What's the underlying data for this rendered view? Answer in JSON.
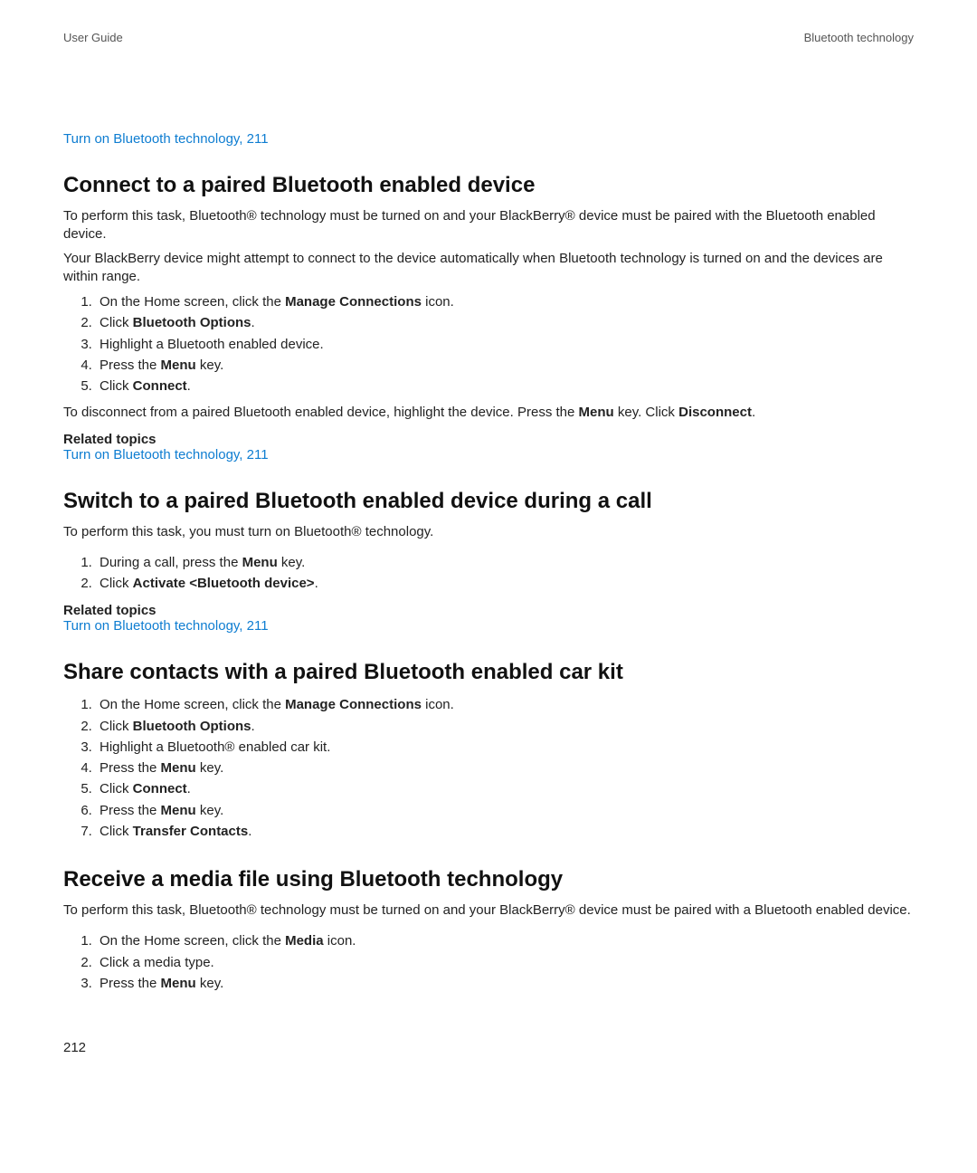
{
  "header": {
    "left": "User Guide",
    "right": "Bluetooth technology"
  },
  "introLink": "Turn on Bluetooth technology, 211",
  "s1": {
    "title": "Connect to a paired Bluetooth enabled device",
    "p1": "To perform this task, Bluetooth® technology must be turned on and your BlackBerry® device must be paired with the Bluetooth enabled device.",
    "p2": "Your BlackBerry device might attempt to connect to the device automatically when Bluetooth technology is turned on and the devices are within range.",
    "steps": {
      "s1a": "On the Home screen, click the ",
      "s1b": "Manage Connections",
      "s1c": " icon.",
      "s2a": "Click ",
      "s2b": "Bluetooth Options",
      "s2c": ".",
      "s3": "Highlight a Bluetooth enabled device.",
      "s4a": "Press the ",
      "s4b": "Menu",
      "s4c": " key.",
      "s5a": "Click ",
      "s5b": "Connect",
      "s5c": "."
    },
    "p3a": "To disconnect from a paired Bluetooth enabled device, highlight the device. Press the ",
    "p3b": "Menu",
    "p3c": " key. Click ",
    "p3d": "Disconnect",
    "p3e": ".",
    "relatedLabel": "Related topics",
    "relatedLink": "Turn on Bluetooth technology, 211"
  },
  "s2": {
    "title": "Switch to a paired Bluetooth enabled device during a call",
    "p1": "To perform this task, you must turn on Bluetooth® technology.",
    "steps": {
      "s1a": "During a call, press the ",
      "s1b": "Menu",
      "s1c": " key.",
      "s2a": "Click ",
      "s2b": "Activate <Bluetooth device>",
      "s2c": "."
    },
    "relatedLabel": "Related topics",
    "relatedLink": "Turn on Bluetooth technology, 211"
  },
  "s3": {
    "title": "Share contacts with a paired Bluetooth enabled car kit",
    "steps": {
      "s1a": "On the Home screen, click the ",
      "s1b": "Manage Connections",
      "s1c": " icon.",
      "s2a": "Click ",
      "s2b": "Bluetooth Options",
      "s2c": ".",
      "s3": "Highlight a Bluetooth® enabled car kit.",
      "s4a": "Press the ",
      "s4b": "Menu",
      "s4c": " key.",
      "s5a": "Click ",
      "s5b": "Connect",
      "s5c": ".",
      "s6a": "Press the ",
      "s6b": "Menu",
      "s6c": " key.",
      "s7a": "Click ",
      "s7b": "Transfer Contacts",
      "s7c": "."
    }
  },
  "s4": {
    "title": "Receive a media file using Bluetooth technology",
    "p1": "To perform this task, Bluetooth® technology must be turned on and your BlackBerry® device must be paired with a Bluetooth enabled device.",
    "steps": {
      "s1a": "On the Home screen, click the ",
      "s1b": "Media",
      "s1c": " icon.",
      "s2": "Click a media type.",
      "s3a": "Press the ",
      "s3b": "Menu",
      "s3c": " key."
    }
  },
  "pageNumber": "212"
}
